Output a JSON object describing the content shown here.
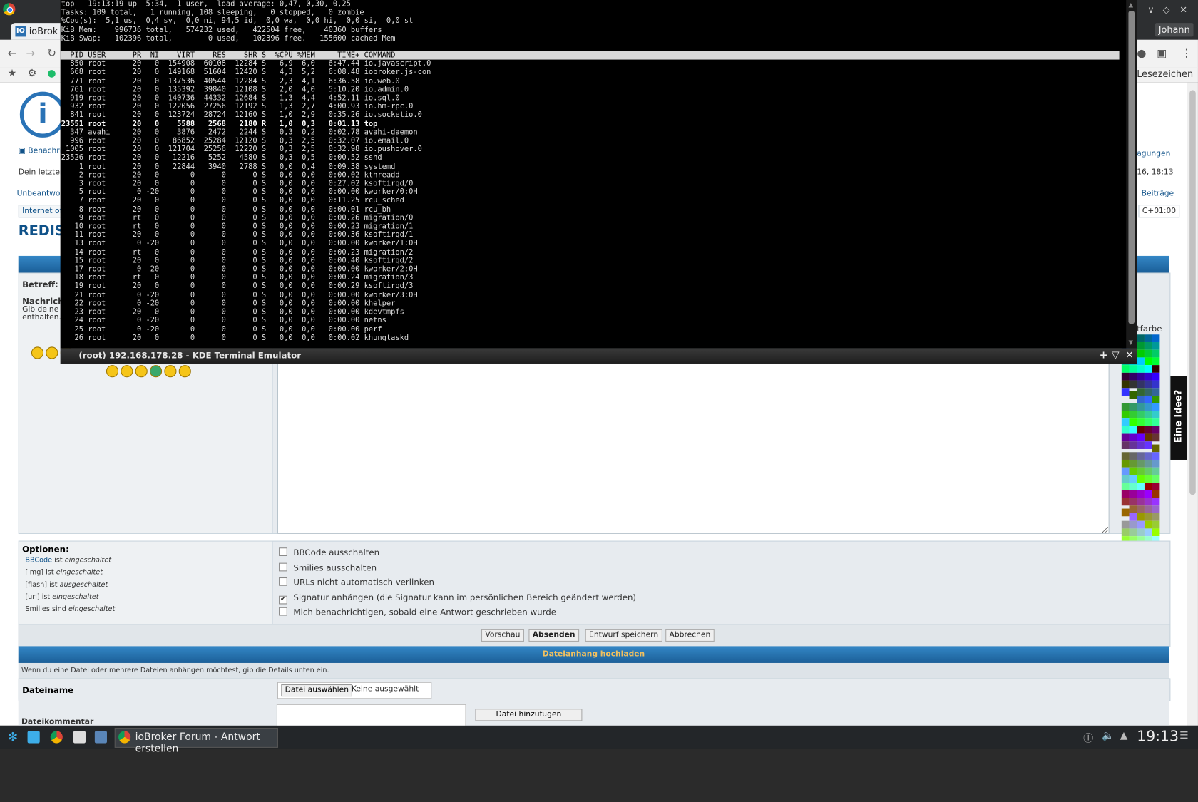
{
  "browser": {
    "tab_title": "ioBrok",
    "tab_favicon": "IO",
    "user": "Johann",
    "bookmarks_label": "Lesezeichen",
    "window_controls": [
      "∨",
      "◇",
      "✕"
    ]
  },
  "forum": {
    "links": {
      "notifications": "Benachri",
      "last_visit": "Dein letzter",
      "unanswered": "Unbeantwor",
      "breadcrumb": "Internet of T",
      "right_questions": "agungen",
      "right_date": "16, 18:13",
      "right_posts": "Beiträge",
      "right_tz": "C+01:00"
    },
    "thread_title": "REDIS",
    "subject_label": "Betreff:",
    "message_label": "Nachricht",
    "message_hint_1": "Gib deine N",
    "message_hint_2": "enthalten.",
    "font_color_label": "iftfarbe",
    "feedback_tab": "Eine Idee?",
    "options": {
      "title": "Optionen:",
      "rules": [
        {
          "code": "BBCode",
          "text": " ist ",
          "state": "eingeschaltet"
        },
        {
          "code": "[img]",
          "text": " ist ",
          "state": "eingeschaltet"
        },
        {
          "code": "[flash]",
          "text": " ist ",
          "state": "ausgeschaltet"
        },
        {
          "code": "[url]",
          "text": " ist ",
          "state": "eingeschaltet"
        },
        {
          "code": "Smilies",
          "text": " sind ",
          "state": "eingeschaltet"
        }
      ],
      "checkboxes": [
        {
          "label": "BBCode ausschalten",
          "checked": false
        },
        {
          "label": "Smilies ausschalten",
          "checked": false
        },
        {
          "label": "URLs nicht automatisch verlinken",
          "checked": false
        },
        {
          "label": "Signatur anhängen (die Signatur kann im persönlichen Bereich geändert werden)",
          "checked": true
        },
        {
          "label": "Mich benachrichtigen, sobald eine Antwort geschrieben wurde",
          "checked": false
        }
      ]
    },
    "buttons": {
      "preview": "Vorschau",
      "submit": "Absenden",
      "save_draft": "Entwurf speichern",
      "cancel": "Abbrechen"
    },
    "upload": {
      "header": "Dateianhang hochladen",
      "note": "Wenn du eine Datei oder mehrere Dateien anhängen möchtest, gib die Details unten ein.",
      "filename_label": "Dateiname",
      "choose_file": "Datei auswählen",
      "no_file": "Keine ausgewählt",
      "comment_label": "Dateikommentar",
      "add_file": "Datei hinzufügen"
    }
  },
  "terminal": {
    "title": "(root) 192.168.178.28 - KDE Terminal Emulator",
    "header_lines": [
      "top - 19:13:19 up  5:34,  1 user,  load average: 0,47, 0,30, 0,25",
      "Tasks: 109 total,   1 running, 108 sleeping,   0 stopped,   0 zombie",
      "%Cpu(s):  5,1 us,  0,4 sy,  0,0 ni, 94,5 id,  0,0 wa,  0,0 hi,  0,0 si,  0,0 st",
      "KiB Mem:    996736 total,   574232 used,   422504 free,    40360 buffers",
      "KiB Swap:   102396 total,        0 used,   102396 free.   155600 cached Mem"
    ],
    "column_header": "  PID USER      PR  NI    VIRT    RES    SHR S  %CPU %MEM     TIME+ COMMAND                                                                                                                                                                                                                 ",
    "processes": [
      "  850 root      20   0  154908  60108  12284 S   6,9  6,0   6:47.44 io.javascript.0",
      "  668 root      20   0  149168  51604  12420 S   4,3  5,2   6:08.48 iobroker.js-con",
      "  771 root      20   0  137536  40544  12284 S   2,3  4,1   6:36.58 io.web.0",
      "  761 root      20   0  135392  39840  12108 S   2,0  4,0   5:10.20 io.admin.0",
      "  919 root      20   0  140736  44332  12684 S   1,3  4,4   4:52.11 io.sql.0",
      "  932 root      20   0  122056  27256  12192 S   1,3  2,7   4:00.93 io.hm-rpc.0",
      "  841 root      20   0  123724  28724  12160 S   1,0  2,9   0:35.26 io.socketio.0",
      "23551 root      20   0    5588   2568   2180 R   1,0  0,3   0:01.13 top",
      "  347 avahi     20   0    3876   2472   2244 S   0,3  0,2   0:02.78 avahi-daemon",
      "  996 root      20   0   86852  25284  12120 S   0,3  2,5   0:32.07 io.email.0",
      " 1005 root      20   0  121704  25256  12220 S   0,3  2,5   0:32.98 io.pushover.0",
      "23526 root      20   0   12216   5252   4580 S   0,3  0,5   0:00.52 sshd",
      "    1 root      20   0   22844   3940   2788 S   0,0  0,4   0:09.38 systemd",
      "    2 root      20   0       0      0      0 S   0,0  0,0   0:00.02 kthreadd",
      "    3 root      20   0       0      0      0 S   0,0  0,0   0:27.02 ksoftirqd/0",
      "    5 root       0 -20       0      0      0 S   0,0  0,0   0:00.00 kworker/0:0H",
      "    7 root      20   0       0      0      0 S   0,0  0,0   0:11.25 rcu_sched",
      "    8 root      20   0       0      0      0 S   0,0  0,0   0:00.01 rcu_bh",
      "    9 root      rt   0       0      0      0 S   0,0  0,0   0:00.26 migration/0",
      "   10 root      rt   0       0      0      0 S   0,0  0,0   0:00.23 migration/1",
      "   11 root      20   0       0      0      0 S   0,0  0,0   0:00.36 ksoftirqd/1",
      "   13 root       0 -20       0      0      0 S   0,0  0,0   0:00.00 kworker/1:0H",
      "   14 root      rt   0       0      0      0 S   0,0  0,0   0:00.23 migration/2",
      "   15 root      20   0       0      0      0 S   0,0  0,0   0:00.40 ksoftirqd/2",
      "   17 root       0 -20       0      0      0 S   0,0  0,0   0:00.00 kworker/2:0H",
      "   18 root      rt   0       0      0      0 S   0,0  0,0   0:00.24 migration/3",
      "   19 root      20   0       0      0      0 S   0,0  0,0   0:00.29 ksoftirqd/3",
      "   21 root       0 -20       0      0      0 S   0,0  0,0   0:00.00 kworker/3:0H",
      "   22 root       0 -20       0      0      0 S   0,0  0,0   0:00.00 khelper",
      "   23 root      20   0       0      0      0 S   0,0  0,0   0:00.00 kdevtmpfs",
      "   24 root       0 -20       0      0      0 S   0,0  0,0   0:00.00 netns",
      "   25 root       0 -20       0      0      0 S   0,0  0,0   0:00.00 perf",
      "   26 root      20   0       0      0      0 S   0,0  0,0   0:00.02 khungtaskd"
    ],
    "bold_row": 7,
    "title_controls": [
      "+",
      "▽",
      "✕"
    ]
  },
  "taskbar": {
    "task_title": "ioBroker Forum - Antwort erstellen",
    "clock": "19:13"
  },
  "colors": {
    "forum_blue": "#105289",
    "header_blue": "#1b5f98",
    "upload_header_text": "#f0c060",
    "terminal_bg": "#000000"
  },
  "palette": [
    "#006600",
    "#006633",
    "#006666",
    "#006699",
    "#0066cc",
    "#0066ff",
    "#009900",
    "#009933",
    "#009966",
    "#009999",
    "#0099cc",
    "#0099ff",
    "#00cc00",
    "#00cc33",
    "#00cc66",
    "#00cc99",
    "#00cccc",
    "#00ccff",
    "#00ff00",
    "#00ff33",
    "#00ff66",
    "#00ff99",
    "#00ffcc",
    "#00ffff",
    "#330000",
    "#330033",
    "#330066",
    "#330099",
    "#3300cc",
    "#3300ff",
    "#333300",
    "#333333",
    "#333366",
    "#333399",
    "#3333cc",
    "#3333ff",
    "#336600",
    "#336633",
    "#336666",
    "#336699",
    "#3366cc",
    "#3366ff",
    "#339900",
    "#339933",
    "#339966",
    "#339999",
    "#3399cc",
    "#3399ff",
    "#33cc00",
    "#33cc33",
    "#33cc66",
    "#33cc99",
    "#33cccc",
    "#33ccff",
    "#33ff00",
    "#33ff33",
    "#33ff66",
    "#33ff99",
    "#33ffcc",
    "#33ffff",
    "#660000",
    "#660033",
    "#660066",
    "#660099",
    "#6600cc",
    "#6600ff",
    "#663300",
    "#663333",
    "#663366",
    "#663399",
    "#6633cc",
    "#6633ff",
    "#666600",
    "#666633",
    "#666666",
    "#666699",
    "#6666cc",
    "#6666ff",
    "#669900",
    "#669933",
    "#669966",
    "#669999",
    "#6699cc",
    "#6699ff",
    "#66cc00",
    "#66cc33",
    "#66cc66",
    "#66cc99",
    "#66cccc",
    "#66ccff",
    "#66ff00",
    "#66ff33",
    "#66ff66",
    "#66ff99",
    "#66ffcc",
    "#66ffff",
    "#990000",
    "#990033",
    "#990066",
    "#990099",
    "#9900cc",
    "#9900ff",
    "#993300",
    "#993333",
    "#993366",
    "#993399",
    "#9933cc",
    "#9933ff",
    "#996600",
    "#996633",
    "#996666",
    "#996699",
    "#9966cc",
    "#9966ff",
    "#999900",
    "#999933",
    "#999966",
    "#999999",
    "#9999cc",
    "#9999ff",
    "#99cc00",
    "#99cc33",
    "#99cc66",
    "#99cc99",
    "#99cccc",
    "#99ccff",
    "#99ff00",
    "#99ff33",
    "#99ff66",
    "#99ff99",
    "#99ffcc",
    "#99ffff",
    "#cc0000",
    "#cc0033",
    "#cc0066",
    "#cc0099",
    "#cc00cc",
    "#cc00ff",
    "#cc3300",
    "#cc3333",
    "#cc3366",
    "#cc3399",
    "#cc33cc",
    "#cc33ff",
    "#cc6600",
    "#cc6633",
    "#cc6666",
    "#cc6699",
    "#cc66cc",
    "#cc66ff",
    "#cc9900",
    "#cc9933",
    "#cc9966",
    "#cc9999",
    "#cc99cc",
    "#cc99ff",
    "#cccc00",
    "#cccc33",
    "#cccc66",
    "#cccc99",
    "#cccccc",
    "#ccccff",
    "#ccff00",
    "#ccff33",
    "#ccff66",
    "#ccff99",
    "#ccffcc",
    "#ccffff",
    "#ff0000",
    "#ff0033",
    "#ff0066",
    "#ff0099",
    "#ff00cc",
    "#ff00ff",
    "#ff3300",
    "#ff3333",
    "#ff3366",
    "#ff3399",
    "#ff33cc",
    "#ff33ff",
    "#ff6600",
    "#ff6633",
    "#ff6666",
    "#ff6699",
    "#ff66cc",
    "#ff66ff",
    "#ff9900",
    "#ff9933",
    "#ff9966",
    "#ff9999",
    "#ff99cc",
    "#ff99ff",
    "#ffcc00",
    "#ffcc33",
    "#ffcc66",
    "#ffcc99",
    "#ffcccc",
    "#ffccff",
    "#ffff00",
    "#ffff33",
    "#ffff66",
    "#ffff99",
    "#ffffcc",
    "#ffffff"
  ]
}
